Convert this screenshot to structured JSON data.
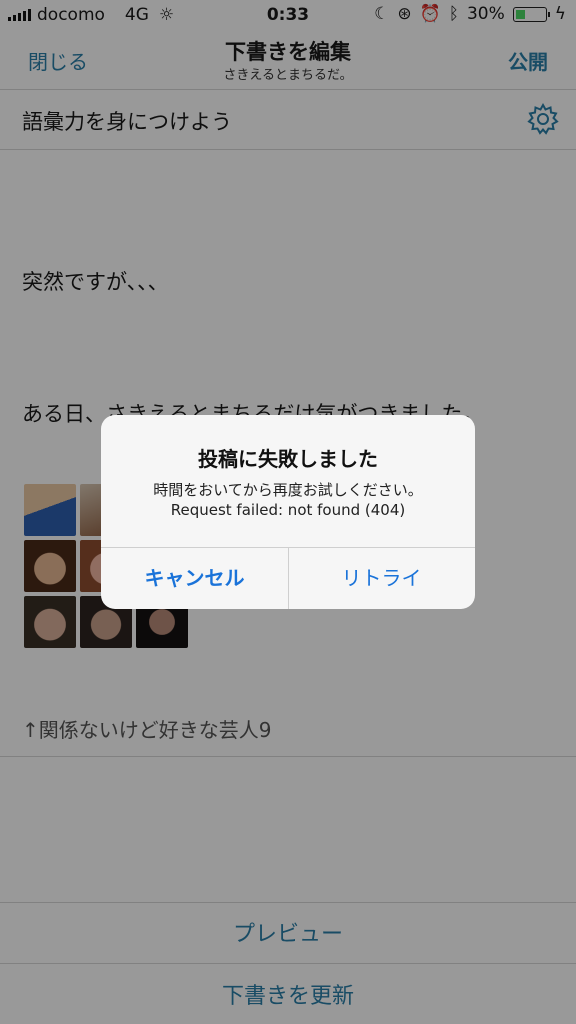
{
  "status_bar": {
    "carrier": "docomo",
    "network": "4G",
    "time": "0:33",
    "battery": "30%"
  },
  "nav": {
    "close": "閉じる",
    "title": "下書きを編集",
    "subtitle": "さきえるとまちるだ。",
    "publish": "公開"
  },
  "editor": {
    "entry_title": "語彙力を身につけよう",
    "line1": "突然ですが、、、",
    "line2": "ある日、さきえるとまちるだけ気がつきました。",
    "caption": "↑関係ないけど好きな芸人9"
  },
  "bottom": {
    "preview": "プレビュー",
    "update_draft": "下書きを更新"
  },
  "alert": {
    "title": "投稿に失敗しました",
    "message1": "時間をおいてから再度お試しください。",
    "message2": "Request failed: not found (404)",
    "cancel": "キャンセル",
    "retry": "リトライ"
  }
}
